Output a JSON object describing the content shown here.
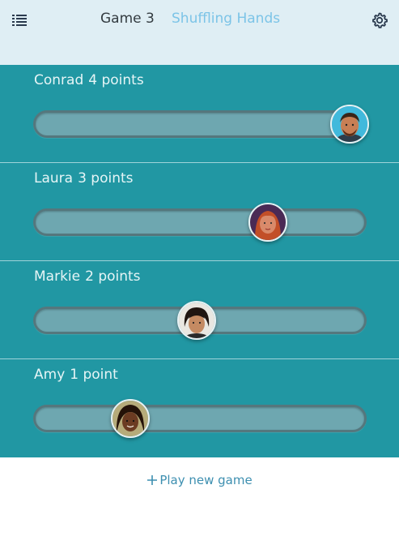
{
  "header": {
    "menu_icon": "list-icon",
    "game_title": "Game 3",
    "status": "Shuffling Hands",
    "settings_icon": "gear-icon"
  },
  "players": [
    {
      "name": "Conrad",
      "score_text": "4 points",
      "progress": 1.0,
      "avatar_colors": {
        "bg": "#41b9dc",
        "skin": "#c77f55",
        "hair": "#3a2418"
      }
    },
    {
      "name": "Laura",
      "score_text": "3 points",
      "progress": 0.727,
      "avatar_colors": {
        "bg": "#4a2a55",
        "skin": "#d98a6a",
        "hair": "#c24f28"
      }
    },
    {
      "name": "Markie",
      "score_text": "2 points",
      "progress": 0.49,
      "avatar_colors": {
        "bg": "#e9e7e1",
        "skin": "#c48a62",
        "hair": "#1f1510"
      }
    },
    {
      "name": "Amy",
      "score_text": "1 point",
      "progress": 0.268,
      "avatar_colors": {
        "bg": "#b6ab7a",
        "skin": "#6b3b22",
        "hair": "#241208"
      }
    }
  ],
  "footer": {
    "new_game_label": "Play new game",
    "new_game_icon": "plus-icon"
  },
  "colors": {
    "header_bg": "#dfeef4",
    "panel_bg": "#2197a3",
    "status_text": "#7cc4e7",
    "link_text": "#3d8fb0"
  }
}
